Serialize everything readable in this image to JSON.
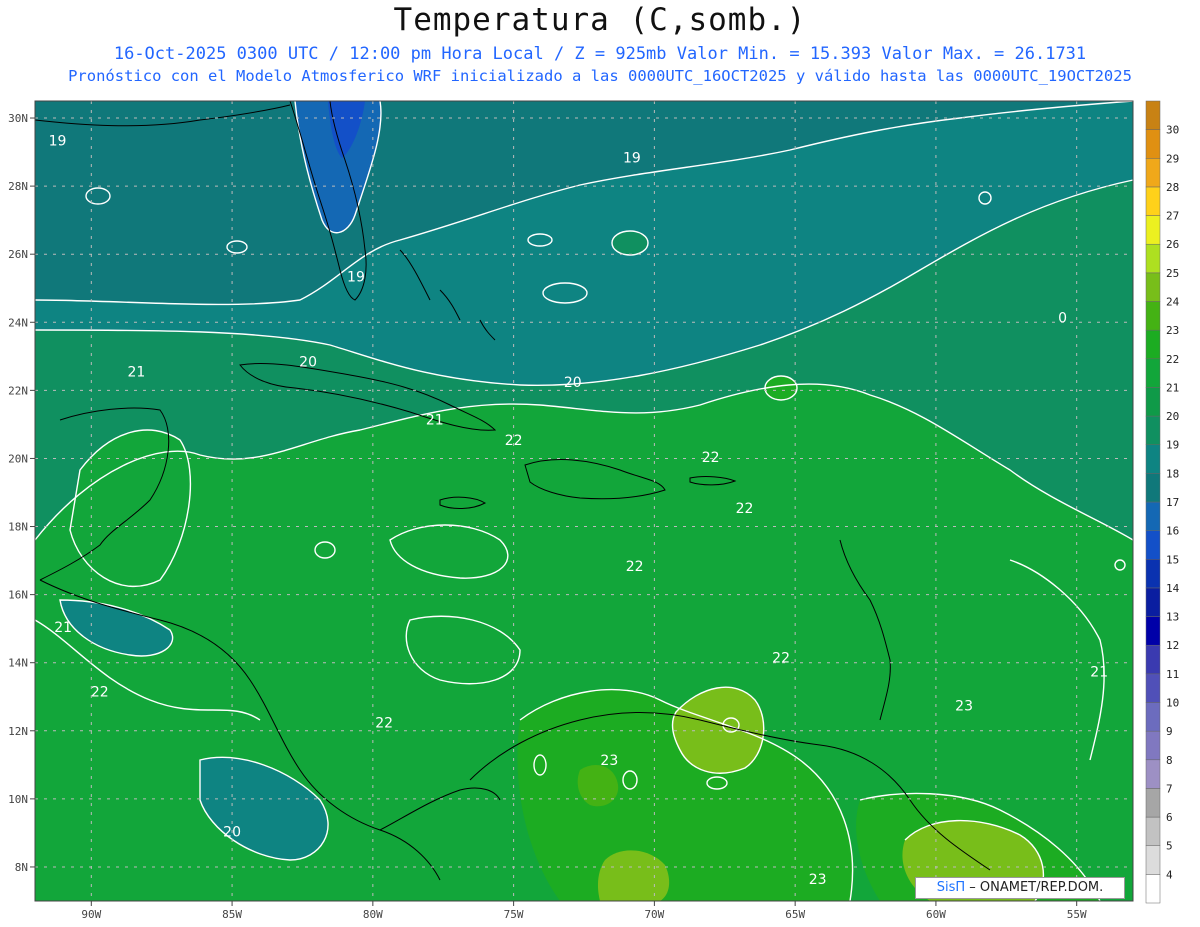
{
  "title": "Temperatura (C,somb.)",
  "subtitle1": "16-Oct-2025  0300 UTC / 12:00 pm Hora Local / Z = 925mb    Valor Min. = 15.393  Valor Max. = 26.1731",
  "subtitle2": "Pronóstico con el Modelo Atmosferico WRF inicializado a las 0000UTC_16OCT2025 y válido hasta las  0000UTC_19OCT2025",
  "credit": {
    "brand": "SisΠ",
    "org": " – ONAMET/REP.DOM."
  },
  "map": {
    "lon_range": [
      -92,
      -53
    ],
    "lat_range": [
      7,
      30.5
    ],
    "lon_ticks": [
      "90W",
      "85W",
      "80W",
      "75W",
      "70W",
      "65W",
      "60W",
      "55W"
    ],
    "lat_ticks": [
      "30N",
      "28N",
      "26N",
      "24N",
      "22N",
      "20N",
      "18N",
      "16N",
      "14N",
      "12N",
      "10N",
      "8N"
    ],
    "grid": true
  },
  "colorbar": {
    "labels": [
      "4",
      "5",
      "6",
      "7",
      "8",
      "9",
      "10",
      "11",
      "12",
      "13",
      "14",
      "15",
      "16",
      "17",
      "18",
      "19",
      "20",
      "21",
      "22",
      "23",
      "24",
      "25",
      "26",
      "27",
      "28",
      "29",
      "30"
    ],
    "colors": [
      "#ffffff",
      "#dcdcdc",
      "#c2c2c2",
      "#a6a6a6",
      "#9d90c4",
      "#8078c0",
      "#6c6cbe",
      "#5050b8",
      "#3a3ab0",
      "#0000a8",
      "#0a1ea0",
      "#0a32b0",
      "#1350c8",
      "#1468b4",
      "#10787a",
      "#0e8482",
      "#109060",
      "#0f9a48",
      "#12a63a",
      "#1cac22",
      "#44b214",
      "#78be1a",
      "#aee020",
      "#ecf020",
      "#ffd11a",
      "#f0a81a",
      "#e09012",
      "#c88214"
    ]
  },
  "contour_labels": [
    {
      "text": "19",
      "lon": -91.2,
      "lat": 29.2
    },
    {
      "text": "19",
      "lon": -70.8,
      "lat": 28.7
    },
    {
      "text": "19",
      "lon": -80.6,
      "lat": 25.2
    },
    {
      "text": "20",
      "lon": -82.3,
      "lat": 22.7
    },
    {
      "text": "20",
      "lon": -72.9,
      "lat": 22.1
    },
    {
      "text": "21",
      "lon": -88.4,
      "lat": 22.4
    },
    {
      "text": "21",
      "lon": -77.8,
      "lat": 21.0
    },
    {
      "text": "22",
      "lon": -75.0,
      "lat": 20.4
    },
    {
      "text": "22",
      "lon": -68.0,
      "lat": 19.9
    },
    {
      "text": "22",
      "lon": -66.8,
      "lat": 18.4
    },
    {
      "text": "22",
      "lon": -70.7,
      "lat": 16.7
    },
    {
      "text": "21",
      "lon": -91.0,
      "lat": 14.9
    },
    {
      "text": "22",
      "lon": -65.5,
      "lat": 14.0
    },
    {
      "text": "21",
      "lon": -54.2,
      "lat": 13.6
    },
    {
      "text": "22",
      "lon": -89.7,
      "lat": 13.0
    },
    {
      "text": "22",
      "lon": -79.6,
      "lat": 12.1
    },
    {
      "text": "23",
      "lon": -59.0,
      "lat": 12.6
    },
    {
      "text": "23",
      "lon": -71.6,
      "lat": 11.0
    },
    {
      "text": "20",
      "lon": -85.0,
      "lat": 8.9
    },
    {
      "text": "23",
      "lon": -64.2,
      "lat": 7.5
    },
    {
      "text": "0",
      "lon": -55.5,
      "lat": 24.0
    }
  ]
}
